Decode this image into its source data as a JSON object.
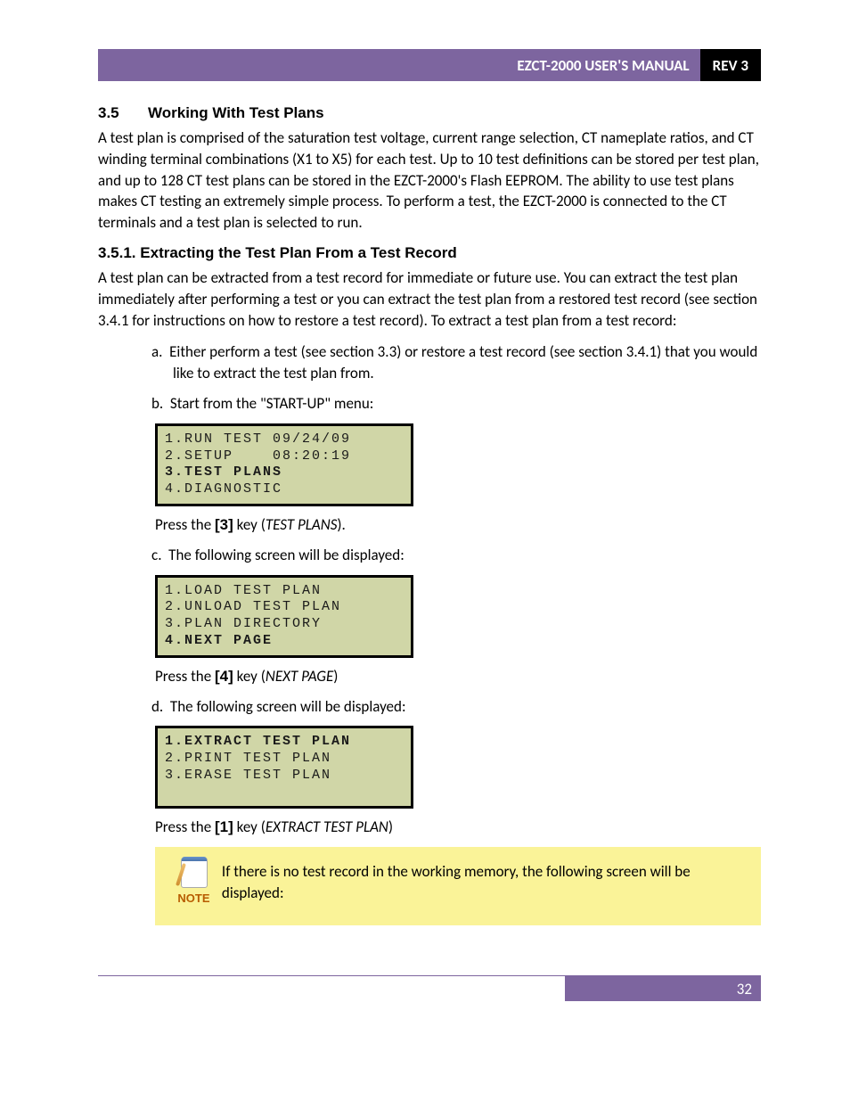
{
  "header": {
    "title": "EZCT-2000 USER'S MANUAL",
    "rev": "REV 3"
  },
  "section": {
    "num": "3.5",
    "title": "Working With Test Plans",
    "body": "A test plan is comprised of the saturation test voltage, current range selection, CT nameplate ratios, and CT winding terminal combinations (X1 to X5) for each test. Up to 10 test definitions can be stored per test plan, and up to 128 CT test plans can be stored in the EZCT-2000's Flash EEPROM. The ability to use test plans makes CT testing an extremely simple process. To perform a test, the EZCT-2000 is connected to the CT terminals and a test plan is selected to run."
  },
  "subsection": {
    "num": "3.5.1.",
    "title": "Extracting the Test Plan From a Test Record",
    "body": "A test plan can be extracted from a test record for immediate or future use. You can extract the test plan immediately after performing a test or you can extract the test plan from a restored test record (see section 3.4.1 for instructions on how to restore a test record). To extract a test plan from a test record:"
  },
  "steps": {
    "a": {
      "label": "a.",
      "text": "Either perform a test (see section 3.3) or restore a test record (see section 3.4.1) that you would like to extract the test plan from."
    },
    "b": {
      "label": "b.",
      "text": "Start from the \"START-UP\" menu:",
      "screen": {
        "line1": "1.RUN TEST 09/24/09",
        "line2": "2.SETUP    08:20:19",
        "line3": "3.TEST PLANS",
        "line4": "4.DIAGNOSTIC"
      },
      "press_pre": "Press the ",
      "key": "[3]",
      "press_mid": " key (",
      "italic": "TEST PLANS",
      "press_post": ")."
    },
    "c": {
      "label": "c.",
      "text": "The following screen will be displayed:",
      "screen": {
        "line1": "1.LOAD TEST PLAN",
        "line2": "2.UNLOAD TEST PLAN",
        "line3": "3.PLAN DIRECTORY",
        "line4": "4.NEXT PAGE"
      },
      "press_pre": "Press the ",
      "key": "[4]",
      "press_mid": " key (",
      "italic": "NEXT PAGE",
      "press_post": ")"
    },
    "d": {
      "label": "d.",
      "text": "The following screen will be displayed:",
      "screen": {
        "line1": "1.EXTRACT TEST PLAN",
        "line2": "2.PRINT TEST PLAN",
        "line3": "3.ERASE TEST PLAN",
        "line4": " "
      },
      "press_pre": "Press the ",
      "key": "[1]",
      "press_mid": " key (",
      "italic": "EXTRACT TEST PLAN",
      "press_post": ")"
    }
  },
  "note": {
    "label": "NOTE",
    "text": "If there is no test record in the working memory, the following screen will be displayed:"
  },
  "page_number": "32"
}
